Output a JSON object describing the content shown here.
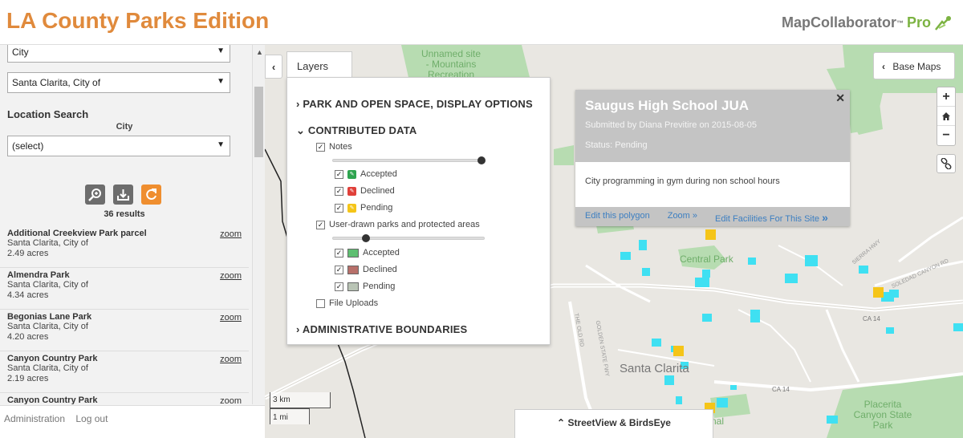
{
  "header": {
    "title": "LA County Parks Edition",
    "brand_name": "MapCollaborator",
    "brand_tm": "™",
    "brand_pro": "Pro"
  },
  "sidebar": {
    "select_type": "City",
    "select_city": "Santa Clarita, City of",
    "location_search_label": "Location Search",
    "city_label": "City",
    "city_select": "(select)",
    "tools": [
      "zoom-search-icon",
      "download-icon",
      "refresh-icon"
    ],
    "results_count": "36 results",
    "zoom_label": "zoom",
    "results": [
      {
        "name": "Additional Creekview Park parcel",
        "city": "Santa Clarita, City of",
        "acres": "2.49 acres"
      },
      {
        "name": "Almendra Park",
        "city": "Santa Clarita, City of",
        "acres": "4.34 acres"
      },
      {
        "name": "Begonias Lane Park",
        "city": "Santa Clarita, City of",
        "acres": "4.20 acres"
      },
      {
        "name": "Canyon Country Park",
        "city": "Santa Clarita, City of",
        "acres": "2.19 acres"
      },
      {
        "name": "Canyon Country Park",
        "city": "",
        "acres": ""
      }
    ],
    "footer": {
      "admin": "Administration",
      "logout": "Log out"
    }
  },
  "layers": {
    "tab_label": "Layers",
    "group_park": "PARK AND OPEN SPACE, DISPLAY OPTIONS",
    "group_contributed": "CONTRIBUTED DATA",
    "notes": "Notes",
    "notes_opacity": 1.0,
    "accepted": "Accepted",
    "declined": "Declined",
    "pending": "Pending",
    "user_drawn": "User-drawn parks and protected areas",
    "user_drawn_opacity": 0.2,
    "file_uploads": "File Uploads",
    "group_admin": "ADMINISTRATIVE BOUNDARIES"
  },
  "popup": {
    "title": "Saugus High School JUA",
    "submitted": "Submitted by Diana Previtire on 2015-08-05",
    "status": "Status: Pending",
    "body": "City programming in gym during non school hours",
    "edit_polygon": "Edit this polygon",
    "zoom": "Zoom »",
    "edit_facilities": "Edit Facilities For This Site",
    "facilities_glyph": "»"
  },
  "map": {
    "base_maps": "Base Maps",
    "scale_km": "3 km",
    "scale_mi": "1 mi",
    "streetview": "StreetView & BirdsEye",
    "labels": {
      "unnamed": "Unnamed site\n- Mountains\nRecreation",
      "central_park": "Central Park",
      "santa_clarita": "Santa Clarita",
      "placerita": "Placerita\nCanyon State\nPark",
      "ca14": "CA 14",
      "sierra_hwy": "SIERRA HWY",
      "soledad": "SOLEDAD CANYON RD",
      "golden_state": "GOLDEN STATE FWY",
      "old_rd": "THE OLD RD",
      "nal": "nal"
    }
  },
  "colors": {
    "title": "#e08a3c",
    "pro": "#7cb342",
    "park_green": "#b7dcb1",
    "contributed_cyan": "#3fe0f2",
    "note_pending": "#f5c518",
    "link_blue": "#3d7fc1"
  }
}
